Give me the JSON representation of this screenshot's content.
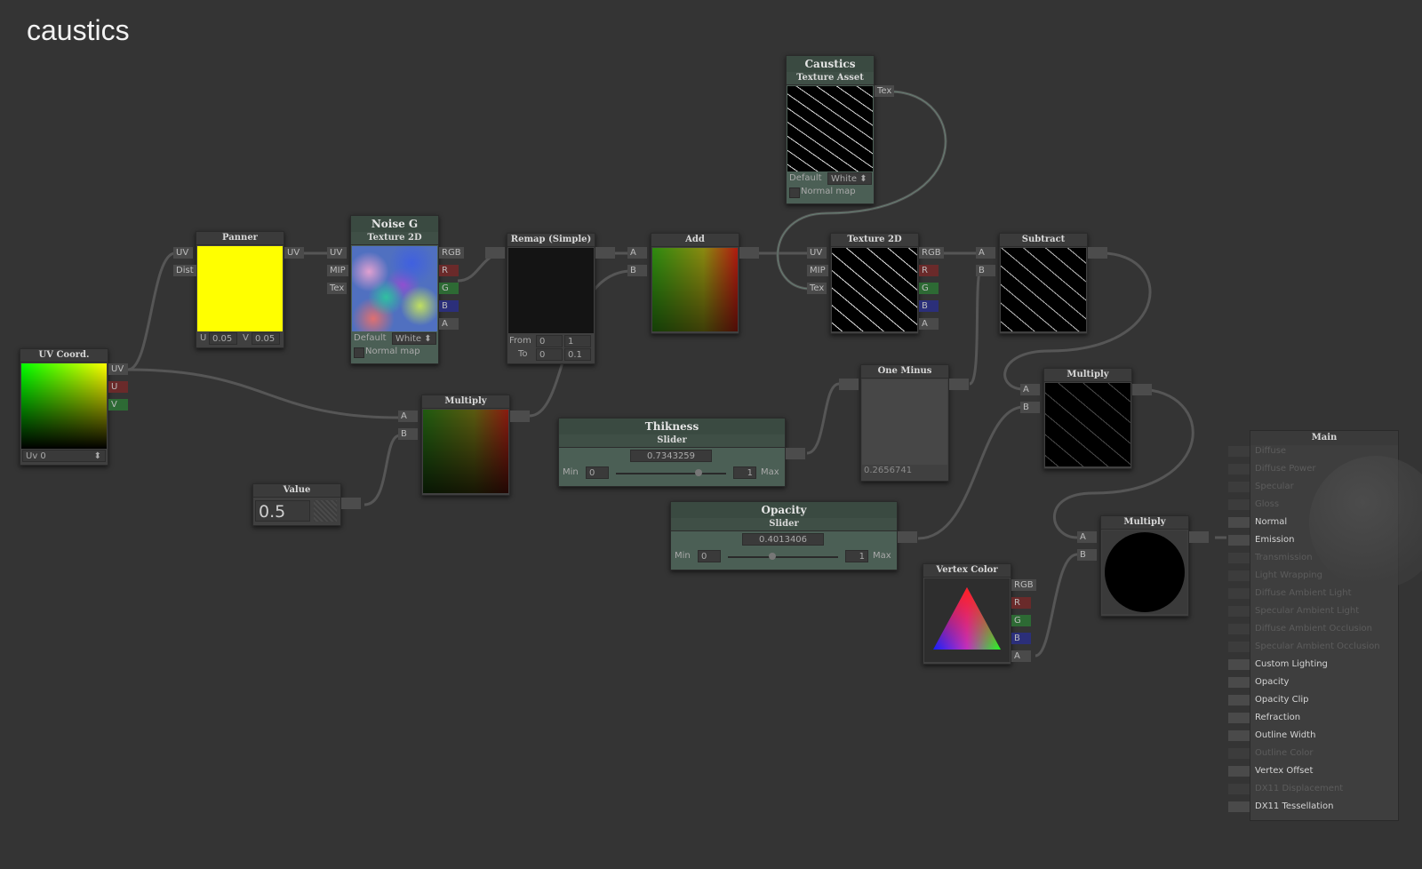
{
  "title": "caustics",
  "nodes": {
    "uv_coord": {
      "title": "UV Coord.",
      "outputs": [
        "UV",
        "U",
        "V"
      ],
      "select": "Uv 0"
    },
    "panner": {
      "title": "Panner",
      "inputs": [
        "UV",
        "Dist"
      ],
      "output": "UV",
      "u_label": "U",
      "u": "0.05",
      "v_label": "V",
      "v": "0.05"
    },
    "noise": {
      "title": "Noise G",
      "subtitle": "Texture 2D",
      "inputs": [
        "UV",
        "MIP",
        "Tex"
      ],
      "outputs": [
        "RGB",
        "R",
        "G",
        "B",
        "A"
      ],
      "default_label": "Default",
      "default_value": "White",
      "normal_map": "Normal map"
    },
    "remap": {
      "title": "Remap (Simple)",
      "from_label": "From",
      "from": [
        "0",
        "1"
      ],
      "to_label": "To",
      "to": [
        "0",
        "0.1"
      ]
    },
    "add": {
      "title": "Add",
      "inputs": [
        "A",
        "B"
      ]
    },
    "caustics": {
      "title": "Caustics",
      "subtitle": "Texture Asset",
      "output": "Tex",
      "default_label": "Default",
      "default_value": "White",
      "normal_map": "Normal map"
    },
    "tex2d": {
      "title": "Texture 2D",
      "inputs": [
        "UV",
        "MIP",
        "Tex"
      ],
      "outputs": [
        "RGB",
        "R",
        "G",
        "B",
        "A"
      ]
    },
    "subtract": {
      "title": "Subtract",
      "inputs": [
        "A",
        "B"
      ]
    },
    "multiply1": {
      "title": "Multiply",
      "inputs": [
        "A",
        "B"
      ]
    },
    "value": {
      "title": "Value",
      "value": "0.5"
    },
    "thikness": {
      "title": "Thikness",
      "subtitle": "Slider",
      "value": "0.7343259",
      "min_label": "Min",
      "min": "0",
      "max": "1",
      "max_label": "Max",
      "fraction": 0.734
    },
    "one_minus": {
      "title": "One Minus",
      "value": "0.2656741"
    },
    "multiply2": {
      "title": "Multiply",
      "inputs": [
        "A",
        "B"
      ]
    },
    "opacity": {
      "title": "Opacity",
      "subtitle": "Slider",
      "value": "0.4013406",
      "min_label": "Min",
      "min": "0",
      "max": "1",
      "max_label": "Max",
      "fraction": 0.401
    },
    "vertex_color": {
      "title": "Vertex Color",
      "outputs": [
        "RGB",
        "R",
        "G",
        "B",
        "A"
      ]
    },
    "multiply3": {
      "title": "Multiply",
      "inputs": [
        "A",
        "B"
      ]
    }
  },
  "main": {
    "title": "Main",
    "inputs": [
      {
        "label": "Diffuse",
        "enabled": false
      },
      {
        "label": "Diffuse Power",
        "enabled": false
      },
      {
        "label": "Specular",
        "enabled": false
      },
      {
        "label": "Gloss",
        "enabled": false
      },
      {
        "label": "Normal",
        "enabled": true
      },
      {
        "label": "Emission",
        "enabled": true
      },
      {
        "label": "Transmission",
        "enabled": false
      },
      {
        "label": "Light Wrapping",
        "enabled": false
      },
      {
        "label": "Diffuse Ambient Light",
        "enabled": false
      },
      {
        "label": "Specular Ambient Light",
        "enabled": false
      },
      {
        "label": "Diffuse Ambient Occlusion",
        "enabled": false
      },
      {
        "label": "Specular Ambient Occlusion",
        "enabled": false
      },
      {
        "label": "Custom Lighting",
        "enabled": true
      },
      {
        "label": "Opacity",
        "enabled": true
      },
      {
        "label": "Opacity Clip",
        "enabled": true
      },
      {
        "label": "Refraction",
        "enabled": true
      },
      {
        "label": "Outline Width",
        "enabled": true
      },
      {
        "label": "Outline Color",
        "enabled": false
      },
      {
        "label": "Vertex Offset",
        "enabled": true
      },
      {
        "label": "DX11 Displacement",
        "enabled": false
      },
      {
        "label": "DX11 Tessellation",
        "enabled": true
      }
    ]
  }
}
